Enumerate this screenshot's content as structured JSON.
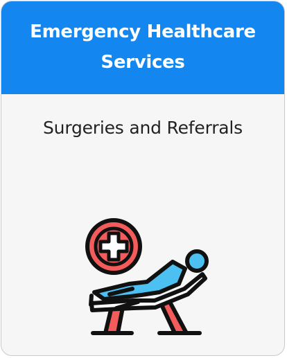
{
  "card": {
    "title": "Emergency Healthcare Services",
    "subtitle": "Surgeries and Referrals",
    "icon": "patient-on-stretcher-with-medical-cross-icon"
  },
  "colors": {
    "header": "#1486f0",
    "card_background": "#f6f6f6",
    "cross_red": "#f45b5b",
    "patient_blue": "#4dc0f2",
    "outline": "#111111"
  }
}
